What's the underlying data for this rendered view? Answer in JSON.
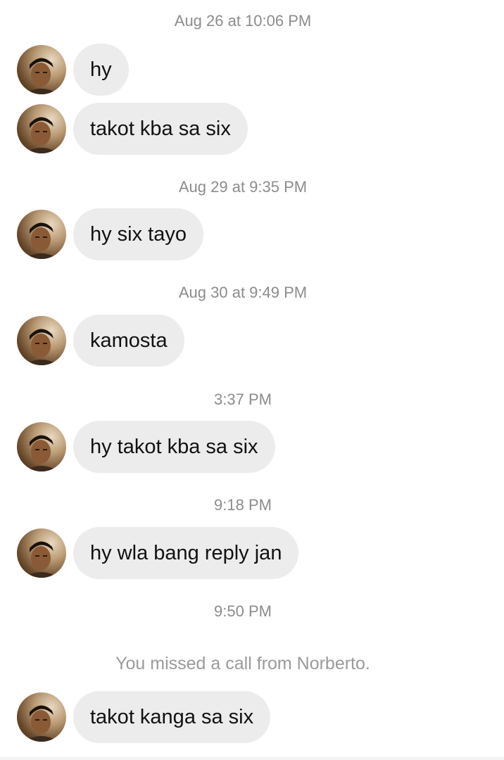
{
  "thread": {
    "timestamps": [
      "Aug 26 at 10:06 PM",
      "Aug 29 at 9:35 PM",
      "Aug 30 at 9:49 PM",
      "3:37 PM",
      "9:18 PM",
      "9:50 PM"
    ],
    "messages": [
      "hy",
      "takot kba sa six",
      "hy six tayo",
      "kamosta",
      "hy takot kba sa six",
      "hy wla bang reply jan",
      "takot kanga sa six"
    ],
    "system_note": "You missed a call from Norberto."
  },
  "colors": {
    "bubble_bg": "#ececec",
    "timestamp_text": "#8c8c8c",
    "system_text": "#9a9a9a"
  },
  "icons": {
    "avatar": "profile-photo"
  }
}
